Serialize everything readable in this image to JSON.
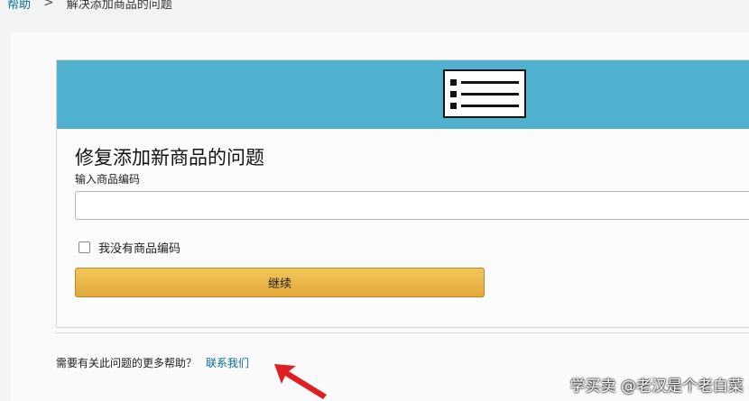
{
  "breadcrumb": {
    "items": [
      "帮助",
      "解决添加商品的问题"
    ],
    "separator": ">"
  },
  "card": {
    "title": "修复添加新商品的问题",
    "input_label": "输入商品编码",
    "input_value": "",
    "checkbox_label": "我没有商品编码",
    "checkbox_checked": false,
    "continue_label": "继续"
  },
  "help": {
    "question": "需要有关此问题的更多帮助？",
    "contact_label": "联系我们"
  },
  "watermark": "学买卖 @老汉是个老白菜",
  "colors": {
    "banner": "#4fb0cf",
    "button": "#e9b445",
    "link": "#0a6e96",
    "arrow": "#e02020"
  },
  "icons": {
    "banner": "list-document-icon",
    "annotation": "red-arrow-icon"
  }
}
